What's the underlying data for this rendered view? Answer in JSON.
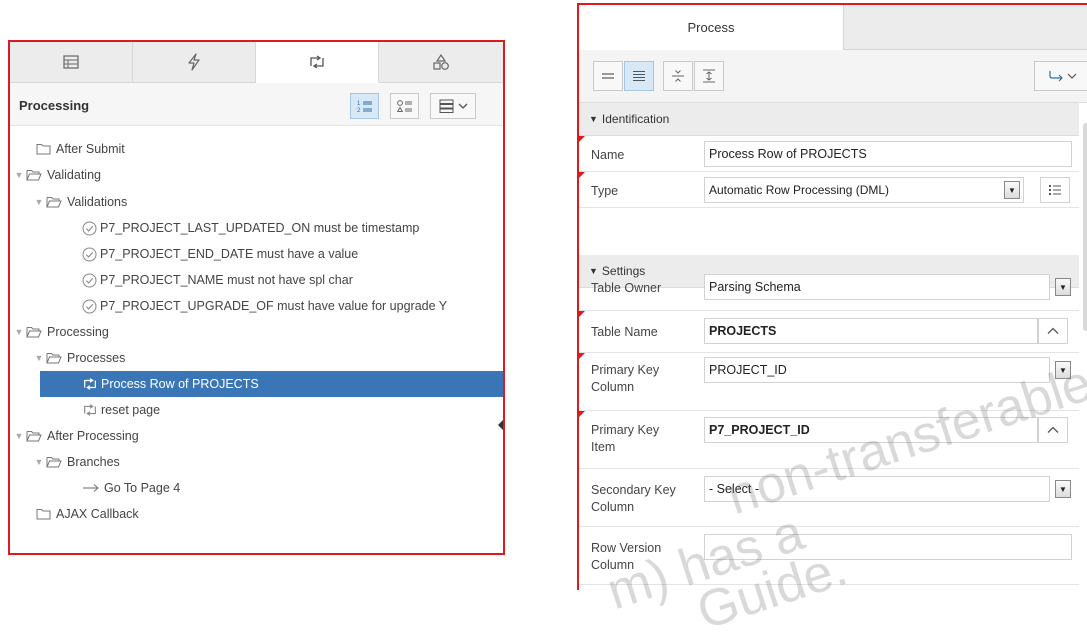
{
  "left_panel": {
    "tabs": [
      {
        "icon": "grid-icon"
      },
      {
        "icon": "lightning-icon"
      },
      {
        "icon": "process-icon"
      },
      {
        "icon": "shapes-icon"
      }
    ],
    "title": "Processing",
    "tree": [
      {
        "label": "After Submit",
        "icon": "folder-icon",
        "expanded": null
      },
      {
        "label": "Validating",
        "icon": "folder-open-icon",
        "expanded": true
      },
      {
        "label": "Validations",
        "icon": "folder-open-icon",
        "expanded": true
      },
      {
        "label": "P7_PROJECT_LAST_UPDATED_ON must be timestamp",
        "icon": "validation-check-icon"
      },
      {
        "label": "P7_PROJECT_END_DATE must have a value",
        "icon": "validation-check-icon"
      },
      {
        "label": "P7_PROJECT_NAME must not have spl char",
        "icon": "validation-check-icon"
      },
      {
        "label": "P7_PROJECT_UPGRADE_OF must have value for upgrade Y",
        "icon": "validation-check-icon"
      },
      {
        "label": "Processing",
        "icon": "folder-open-icon",
        "expanded": true
      },
      {
        "label": "Processes",
        "icon": "folder-open-icon",
        "expanded": true
      },
      {
        "label": "Process Row of PROJECTS",
        "icon": "process-icon",
        "selected": true
      },
      {
        "label": "reset page",
        "icon": "process-icon"
      },
      {
        "label": "After Processing",
        "icon": "folder-open-icon",
        "expanded": true
      },
      {
        "label": "Branches",
        "icon": "folder-open-icon",
        "expanded": true
      },
      {
        "label": "Go To Page 4",
        "icon": "arrow-right-icon"
      },
      {
        "label": "AJAX Callback",
        "icon": "folder-icon"
      }
    ]
  },
  "right_panel": {
    "tab_label": "Process",
    "sections": {
      "identification": "Identification",
      "settings": "Settings"
    },
    "fields": {
      "name": {
        "label": "Name",
        "value": "Process Row of PROJECTS"
      },
      "type": {
        "label": "Type",
        "value": "Automatic Row Processing (DML)"
      },
      "table_owner": {
        "label": "Table Owner",
        "value": "Parsing Schema"
      },
      "table_name": {
        "label": "Table Name",
        "value": "PROJECTS"
      },
      "primary_key_column": {
        "label": "Primary Key Column",
        "value": "PROJECT_ID"
      },
      "primary_key_item": {
        "label": "Primary Key Item",
        "value": "P7_PROJECT_ID"
      },
      "secondary_key_column": {
        "label": "Secondary Key Column",
        "value": "- Select -"
      },
      "row_version_column": {
        "label": "Row Version Column",
        "value": ""
      }
    }
  },
  "watermark": {
    "line1": "non-transferable",
    "line2": "m) has a",
    "line3": "Guide."
  }
}
